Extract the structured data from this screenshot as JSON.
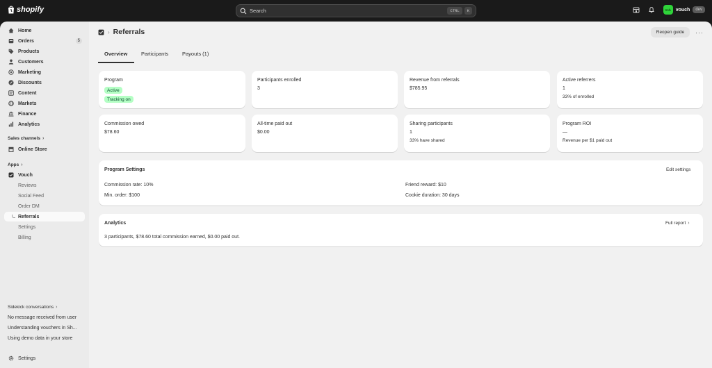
{
  "topbar": {
    "brand": "shopify",
    "search_label": "Search",
    "shortcut_keys": [
      "CTRL",
      "K"
    ],
    "store_name": "vouch",
    "store_avatar_text": "Vch",
    "env_badge": "dev"
  },
  "sidebar": {
    "main": [
      {
        "label": "Home",
        "icon": "home-icon"
      },
      {
        "label": "Orders",
        "icon": "orders-icon",
        "badge": "5"
      },
      {
        "label": "Products",
        "icon": "tag-icon"
      },
      {
        "label": "Customers",
        "icon": "person-icon"
      },
      {
        "label": "Marketing",
        "icon": "target-icon"
      },
      {
        "label": "Discounts",
        "icon": "discount-icon"
      },
      {
        "label": "Content",
        "icon": "content-icon"
      },
      {
        "label": "Markets",
        "icon": "globe-icon"
      },
      {
        "label": "Finance",
        "icon": "bank-icon"
      },
      {
        "label": "Analytics",
        "icon": "chart-icon"
      }
    ],
    "sales_channels_label": "Sales channels",
    "online_store": "Online Store",
    "apps_label": "Apps",
    "vouch": "Vouch",
    "vouch_sub": [
      "Reviews",
      "Social Feed",
      "Order DM",
      "Referrals",
      "Settings",
      "Billing"
    ],
    "sidekick_label": "Sidekick conversations",
    "sidekick_items": [
      "No message received from user",
      "Understanding vouchers in Sh...",
      "Using demo data in your store"
    ],
    "settings": "Settings"
  },
  "page": {
    "title": "Referrals",
    "reopen_guide": "Reopen guide",
    "more": "···",
    "tabs": [
      "Overview",
      "Participants",
      "Payouts (1)"
    ]
  },
  "cards": {
    "program_label": "Program",
    "program_status": "Active",
    "program_tracking": "Tracking on",
    "participants_label": "Participants enrolled",
    "participants_value": "3",
    "revenue_label": "Revenue from referrals",
    "revenue_value": "$785.95",
    "referrers_label": "Active referrers",
    "referrers_value": "1",
    "referrers_note": "33% of enrolled",
    "commission_label": "Commission owed",
    "commission_value": "$78.60",
    "paid_label": "All-time paid out",
    "paid_value": "$0.00",
    "sharing_label": "Sharing participants",
    "sharing_value": "1",
    "sharing_note": "33% have shared",
    "roi_label": "Program ROI",
    "roi_value": "—",
    "roi_note": "Revenue per $1 paid out"
  },
  "settings_card": {
    "title": "Program Settings",
    "edit": "Edit settings",
    "commission_rate": "Commission rate: 10%",
    "min_order": "Min. order: $100",
    "friend_reward": "Friend reward: $10",
    "cookie_duration": "Cookie duration: 30 days"
  },
  "analytics_card": {
    "title": "Analytics",
    "full_report": "Full report",
    "summary": "3 participants, $78.60 total commission earned, $0.00 paid out."
  },
  "colors": {
    "topbar": "#1a1a1a",
    "sidebar": "#ebebeb",
    "content": "#f1f1f1",
    "pill_bg": "#b4fec4",
    "pill_text": "#0c5132",
    "avatar": "#2fd33a"
  }
}
